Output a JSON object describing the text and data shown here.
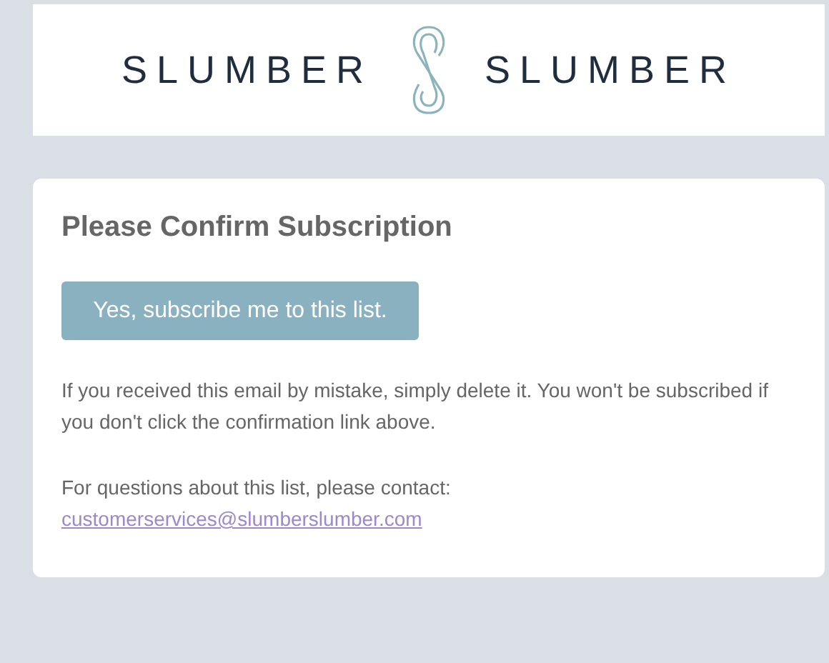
{
  "header": {
    "logo_words": [
      "SLUMBER",
      "SLUMBER"
    ]
  },
  "card": {
    "title": "Please Confirm Subscription",
    "button": "Yes, subscribe me to this list.",
    "note": "If you received this email by mistake, simply delete it. You won't be subscribed if you don't click the confirmation link above.",
    "contact": {
      "text": "For questions about this list, please contact:",
      "link": "customerservices@slumberslumber.com"
    }
  }
}
